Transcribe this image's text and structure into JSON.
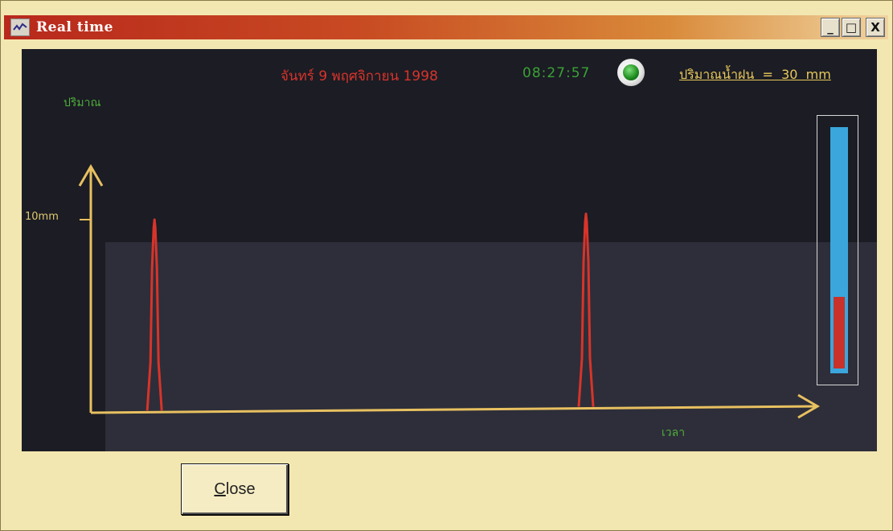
{
  "window": {
    "title": "Real time",
    "buttons": {
      "minimize": "_",
      "maximize": "□",
      "close": "X"
    }
  },
  "display": {
    "date": "จันทร์ 9 พฤศจิกายน 1998",
    "time": "08:27:57",
    "rain_readout": "ปริมาณน้ำฝน  =  30  mm",
    "status_led_color": "#1c8a1c"
  },
  "chart_data": {
    "type": "line",
    "ylabel": "ปริมาณ",
    "xlabel": "เวลา",
    "y_ticks": [
      "10mm"
    ],
    "ylim": [
      0,
      10
    ],
    "series": [
      {
        "color": "#d8342a",
        "spikes": [
          {
            "x": 0.09,
            "y": 10
          },
          {
            "x": 0.7,
            "y": 10.3
          }
        ]
      }
    ]
  },
  "gauge": {
    "level_fraction": 0.29,
    "tube_color": "#3aa6dc",
    "fill_color": "#c8322a"
  },
  "footer": {
    "close_accel": "C",
    "close_rest": "lose"
  }
}
